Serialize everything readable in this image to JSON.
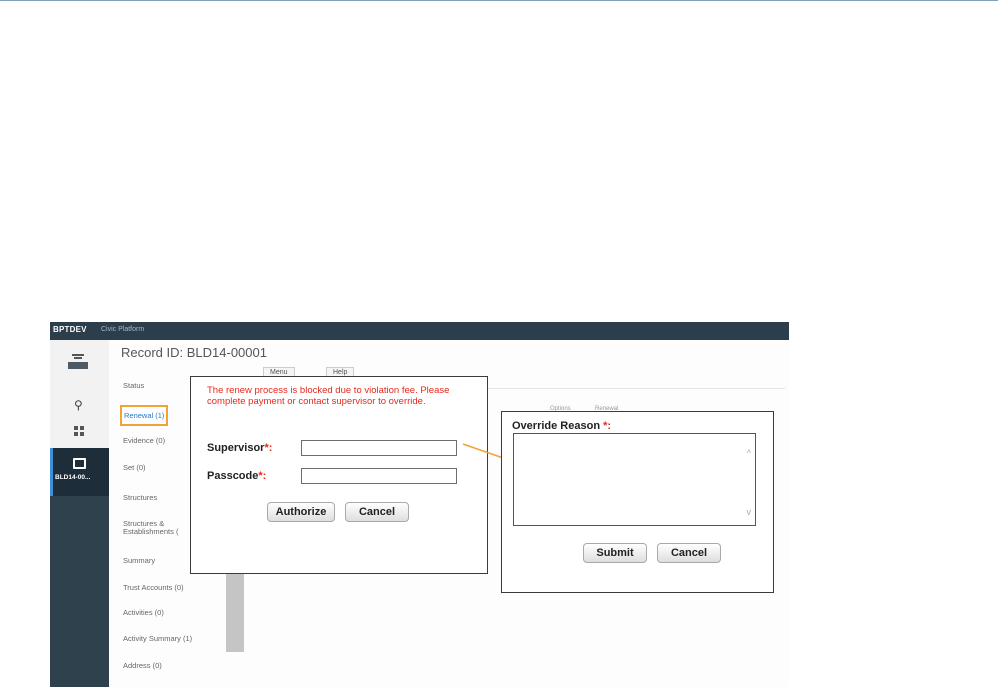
{
  "app": {
    "brand": "BPTDEV",
    "platform": "Civic Platform",
    "record_title": "Record ID: BLD14-00001",
    "nav_record_label": "BLD14-00...",
    "top_buttons": [
      "Menu",
      "Help"
    ],
    "faint_tabs": [
      "Options",
      "Renewal"
    ]
  },
  "sidebar": {
    "items": [
      {
        "label": "Status"
      },
      {
        "label": "Renewal (1)"
      },
      {
        "label": "Evidence (0)"
      },
      {
        "label": "Set (0)"
      },
      {
        "label": "Structures"
      },
      {
        "label": "Structures &"
      },
      {
        "label": "Establishments ("
      },
      {
        "label": "Summary"
      },
      {
        "label": "Trust Accounts (0)"
      },
      {
        "label": "Activities (0)"
      },
      {
        "label": "Activity Summary (1)"
      },
      {
        "label": "Address (0)"
      }
    ]
  },
  "auth_dialog": {
    "message": "The renew process is blocked due to violation fee. Please complete payment or contact supervisor to override.",
    "supervisor_label": "Supervisor",
    "passcode_label": "Passcode",
    "required_mark": "*:",
    "supervisor_value": "",
    "passcode_value": "",
    "authorize_label": "Authorize",
    "cancel_label": "Cancel"
  },
  "override_dialog": {
    "label": "Override Reason",
    "required_mark": "*:",
    "reason_value": "",
    "submit_label": "Submit",
    "cancel_label": "Cancel"
  },
  "colors": {
    "error_text": "#e8281c",
    "appbar": "#2c3e4c",
    "highlight_border": "#f0a33a",
    "arrow": "#f0a33a"
  }
}
